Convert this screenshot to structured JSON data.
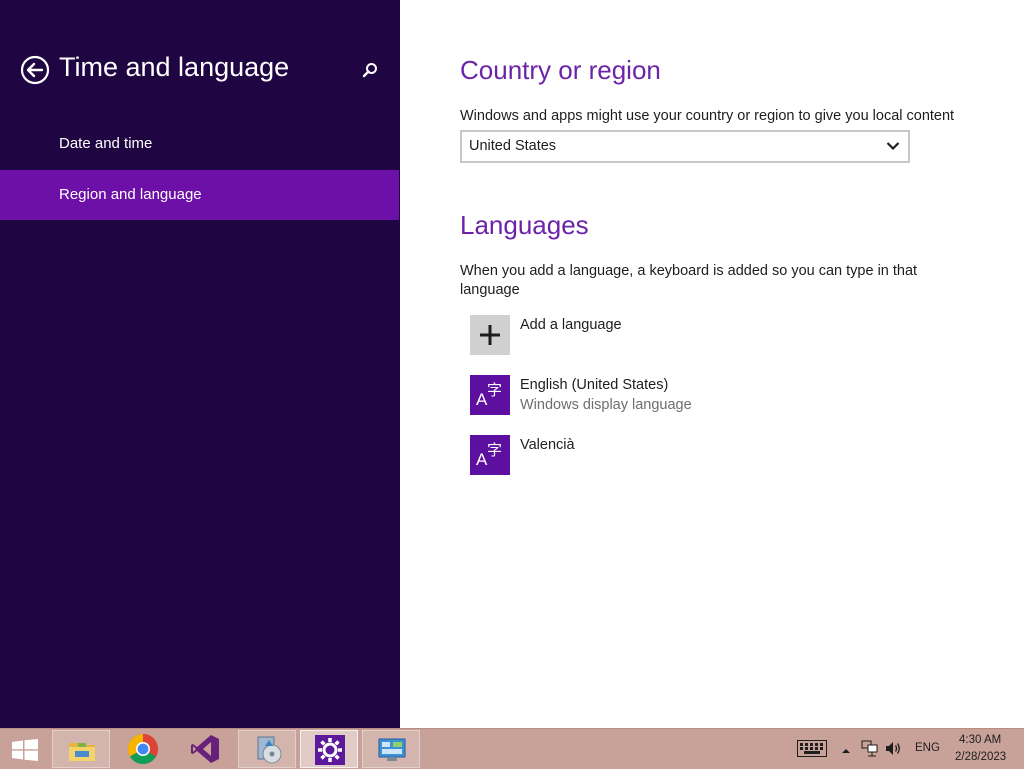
{
  "left": {
    "title": "Time and language",
    "nav": [
      {
        "label": "Date and time",
        "active": false
      },
      {
        "label": "Region and language",
        "active": true
      }
    ]
  },
  "country": {
    "heading": "Country or region",
    "description": "Windows and apps might use your country or region to give you local content",
    "selected": "United States"
  },
  "languages": {
    "heading": "Languages",
    "description_line1": "When you add a language, a keyboard is added so you can type in that",
    "description_line2": "language",
    "add_label": "Add a language",
    "items": [
      {
        "name": "English (United States)",
        "sub": "Windows display language",
        "glyph_latin": "A",
        "glyph_cjk": "字"
      },
      {
        "name": "Valencià",
        "sub": "",
        "glyph_latin": "A",
        "glyph_cjk": "字"
      }
    ]
  },
  "taskbar": {
    "apps": [
      "start-icon",
      "file-explorer-icon",
      "chrome-icon",
      "visual-studio-icon",
      "media-installer-icon",
      "settings-icon",
      "control-panel-icon"
    ],
    "tray": {
      "language": "ENG",
      "time": "4:30 AM",
      "date": "2/28/2023"
    }
  },
  "colors": {
    "left_bg": "#1f0541",
    "active_nav": "#6d10a8",
    "accent_heading": "#6b24a8",
    "language_tile": "#5d0fa0",
    "taskbar": "#c8a198"
  }
}
